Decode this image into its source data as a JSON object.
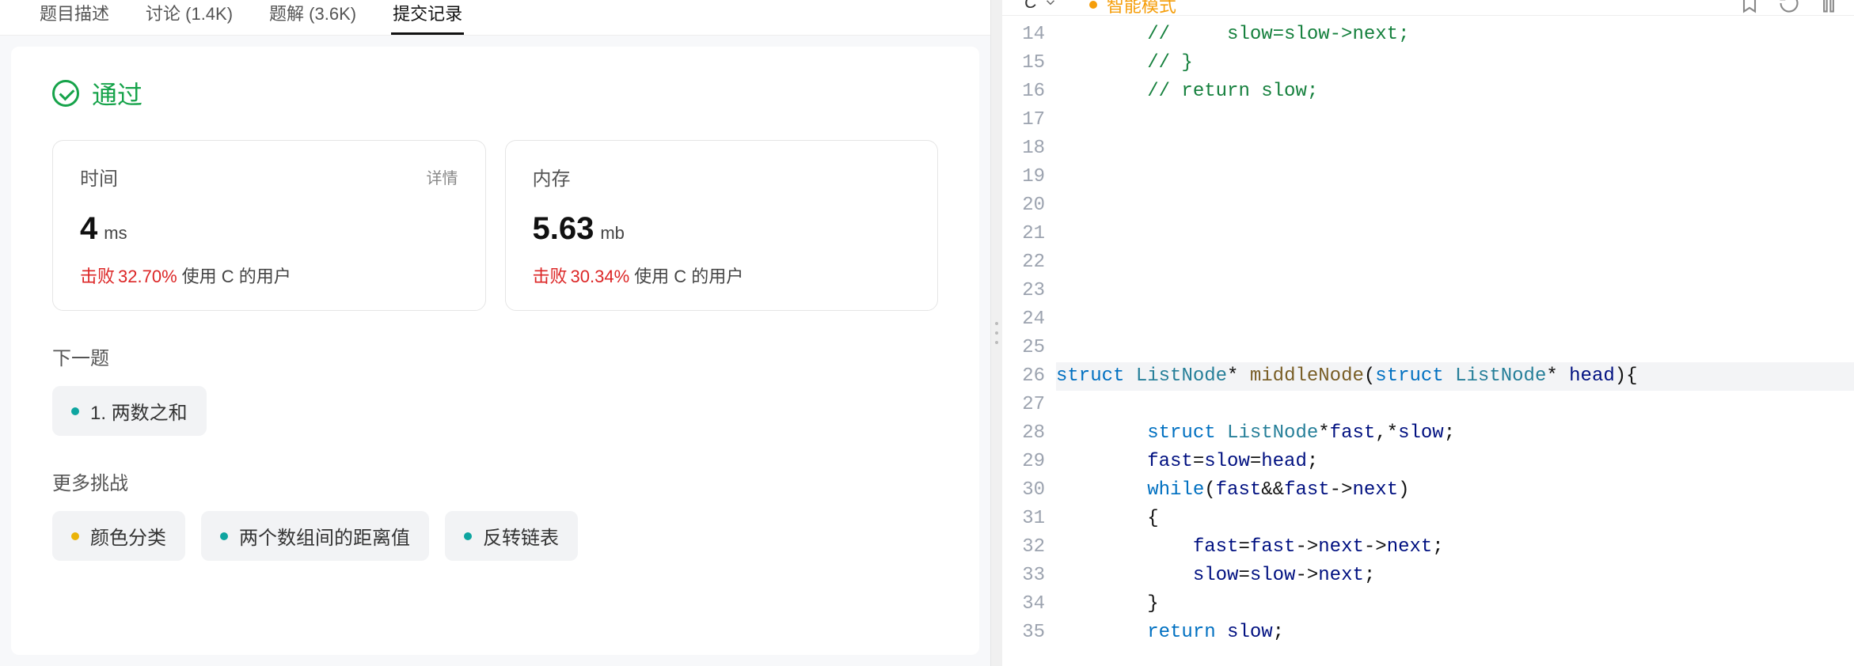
{
  "tabs": [
    {
      "label": "题目描述"
    },
    {
      "label": "讨论 (1.4K)"
    },
    {
      "label": "题解 (3.6K)"
    },
    {
      "label": "提交记录"
    }
  ],
  "active_tab": 3,
  "status": {
    "text": "通过"
  },
  "metrics": {
    "time": {
      "title": "时间",
      "detail_label": "详情",
      "value": "4",
      "unit": "ms",
      "beat_prefix": "击败",
      "beat_pct": "32.70%",
      "beat_rest": "使用 C 的用户"
    },
    "memory": {
      "title": "内存",
      "value": "5.63",
      "unit": "mb",
      "beat_prefix": "击败",
      "beat_pct": "30.34%",
      "beat_rest": "使用 C 的用户"
    }
  },
  "sections": {
    "next_title": "下一题",
    "next_items": [
      {
        "dot": "teal",
        "label": "1. 两数之和"
      }
    ],
    "more_title": "更多挑战",
    "more_items": [
      {
        "dot": "yellow",
        "label": "颜色分类"
      },
      {
        "dot": "teal",
        "label": "两个数组间的距离值"
      },
      {
        "dot": "teal",
        "label": "反转链表"
      }
    ]
  },
  "editor": {
    "language": "C",
    "mode": "智能模式",
    "first_line": 14,
    "lines": [
      {
        "type": "comment",
        "text": "//     slow=slow->next;"
      },
      {
        "type": "comment",
        "text": "// }"
      },
      {
        "type": "comment",
        "text": "// return slow;"
      },
      {
        "type": "blank"
      },
      {
        "type": "blank"
      },
      {
        "type": "blank"
      },
      {
        "type": "blank"
      },
      {
        "type": "blank"
      },
      {
        "type": "blank"
      },
      {
        "type": "blank"
      },
      {
        "type": "blank"
      },
      {
        "type": "blank"
      },
      {
        "type": "funcdecl",
        "active": true
      },
      {
        "type": "blank"
      },
      {
        "type": "vardecl"
      },
      {
        "type": "assign"
      },
      {
        "type": "while"
      },
      {
        "type": "lbrace"
      },
      {
        "type": "fastnext"
      },
      {
        "type": "slownext"
      },
      {
        "type": "rbrace"
      },
      {
        "type": "return"
      }
    ]
  }
}
